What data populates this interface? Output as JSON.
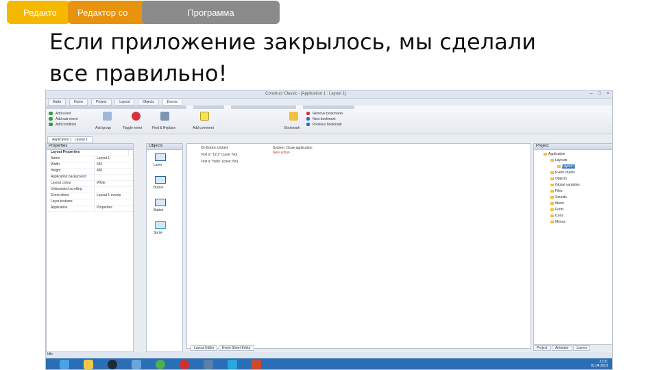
{
  "tabs": [
    {
      "label": "Редакто"
    },
    {
      "label": "Редактор со"
    },
    {
      "label": "Программа"
    }
  ],
  "heading": {
    "line1": "Если приложение закрылось, мы сделали",
    "line2": "все правильно!"
  },
  "app": {
    "window_title": "Construct Classic - [Application 1 : Layout 1]",
    "menu": [
      "Файл",
      "Home",
      "Project",
      "Layout",
      "Objects",
      "Events"
    ],
    "ribbon": {
      "add_event": "Add event",
      "add_sub_event": "Add sub-event",
      "add_condition": "Add condition",
      "add_group": "Add group",
      "toggle_event": "Toggle event",
      "find_replace": "Find & Replace",
      "add_comment": "Add comment",
      "bookmark": "Bookmark",
      "remove_bookmarks": "Remove bookmarks",
      "next_bookmark": "Next bookmark",
      "previous_bookmark": "Previous bookmark"
    },
    "doc_tab": "Application 1 : Layout 1",
    "properties": {
      "title": "Properties",
      "section": "Layout Properties",
      "rows": [
        {
          "k": "Name",
          "v": "Layout 1"
        },
        {
          "k": "Width",
          "v": "640"
        },
        {
          "k": "Height",
          "v": "480"
        },
        {
          "k": "Application background",
          "v": ""
        },
        {
          "k": "Layout colour",
          "v": "White"
        },
        {
          "k": "Unbounded scrolling",
          "v": ""
        },
        {
          "k": "Event sheet",
          "v": "Layout 1 events"
        },
        {
          "k": "Layer textures",
          "v": ""
        },
        {
          "k": "Application",
          "v": "Properties"
        }
      ]
    },
    "objects": {
      "title": "Objects",
      "items": [
        "Layer",
        "Button",
        "Button",
        "Sprite"
      ]
    },
    "events": {
      "conditions": [
        "On Button clicked",
        "Text is \"12:2\" (case: No)",
        "Text is \"hello\" (case: No)"
      ],
      "actions": [
        "System: Close application",
        "New action"
      ]
    },
    "project": {
      "title": "Project",
      "items": [
        "Application",
        "Layouts",
        "Layout 1",
        "Event sheets",
        "Objects",
        "Global variables",
        "Files",
        "Sounds",
        "Music",
        "Fonts",
        "Icons",
        "Menus"
      ],
      "tabs": [
        "Project",
        "Animator",
        "Layers"
      ]
    },
    "bottom_tabs": [
      "Layout Editor",
      "Event Sheet Editor"
    ],
    "status": "Idle",
    "clock": {
      "time": "21:31",
      "date": "01.04.2013"
    }
  },
  "colors": {
    "tab1": "#f5b800",
    "tab2": "#e8930e",
    "tab3": "#8b8b8b",
    "taskbar": "#2a6fb6"
  }
}
